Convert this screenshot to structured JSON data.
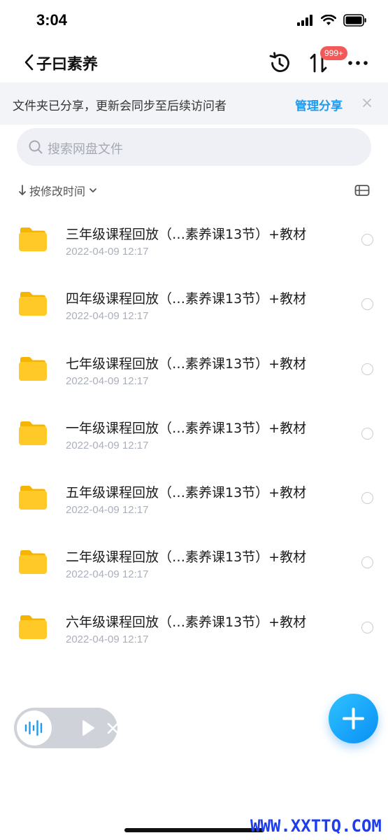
{
  "status_bar": {
    "time": "3:04",
    "icons": [
      "signal-icon",
      "wifi-icon",
      "battery-icon"
    ]
  },
  "header": {
    "title": "子曰素养",
    "transfer_badge": "999+",
    "icons": [
      "chevron-left-icon",
      "history-icon",
      "transfer-icon",
      "more-icon"
    ]
  },
  "share_banner": {
    "text": "文件夹已分享，更新会同步至后续访问者",
    "action_label": "管理分享"
  },
  "search": {
    "placeholder": "搜索网盘文件"
  },
  "sort": {
    "label": "按修改时间"
  },
  "files": [
    {
      "name": "三年级课程回放（…素养课13节）+教材",
      "date": "2022-04-09 12:17"
    },
    {
      "name": "四年级课程回放（…素养课13节）+教材",
      "date": "2022-04-09 12:17"
    },
    {
      "name": "七年级课程回放（…素养课13节）+教材",
      "date": "2022-04-09 12:17"
    },
    {
      "name": "一年级课程回放（…素养课13节）+教材",
      "date": "2022-04-09 12:17"
    },
    {
      "name": "五年级课程回放（…素养课13节）+教材",
      "date": "2022-04-09 12:17"
    },
    {
      "name": "二年级课程回放（…素养课13节）+教材",
      "date": "2022-04-09 12:17"
    },
    {
      "name": "六年级课程回放（…素养课13节）+教材",
      "date": "2022-04-09 12:17"
    }
  ],
  "watermark": "WWW.XXTTQ.COM",
  "colors": {
    "accent": "#1e9bf0",
    "badge": "#f25a5a",
    "folder": "#ffc928",
    "watermark": "#1d3df0"
  }
}
